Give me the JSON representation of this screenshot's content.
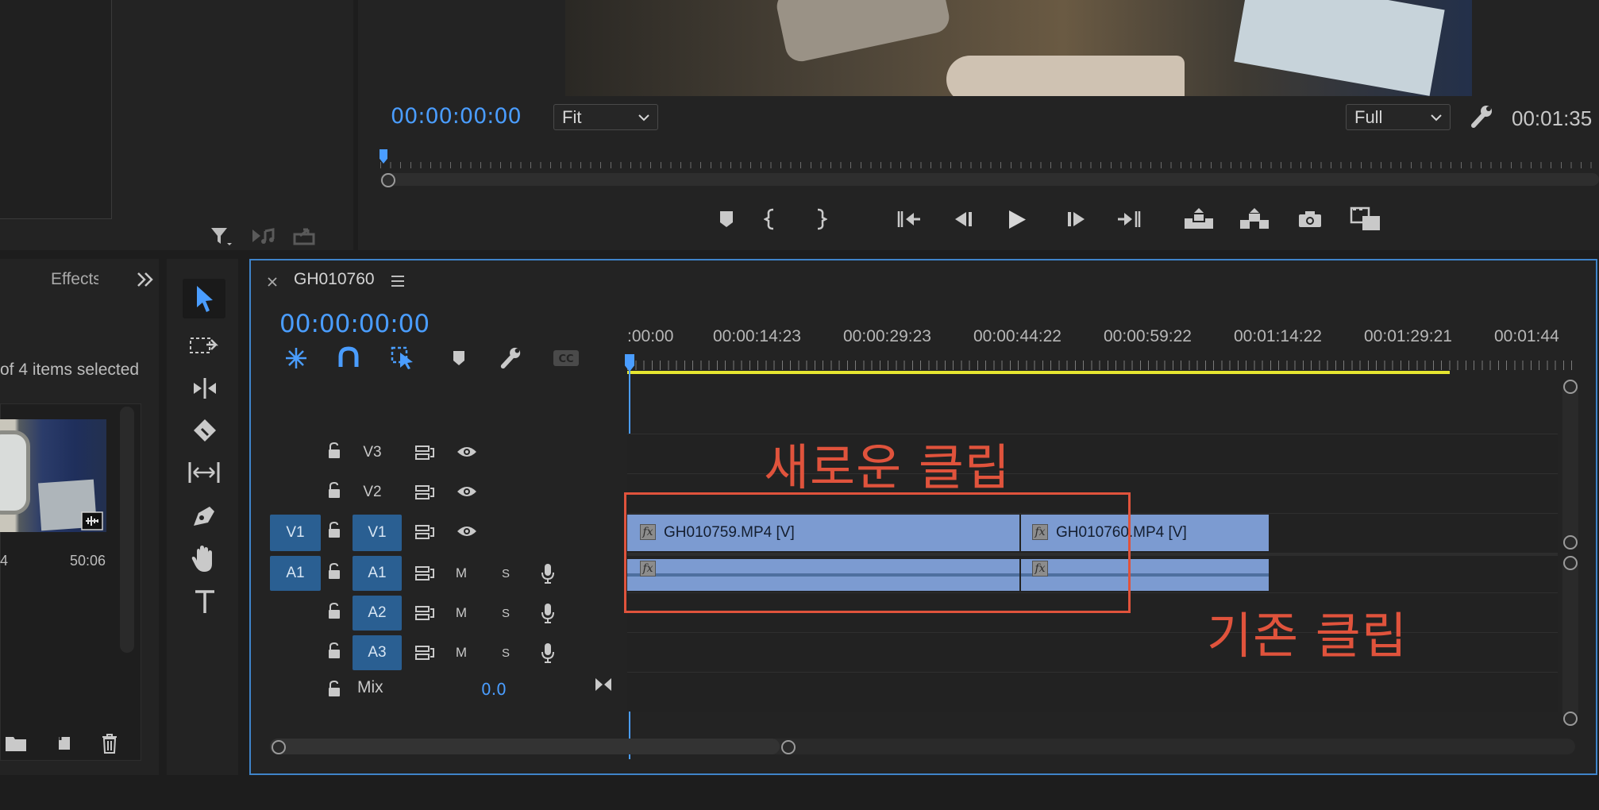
{
  "program_monitor": {
    "timecode": "00:00:00:00",
    "fit_select": "Fit",
    "quality_select": "Full",
    "duration": "00:01:35",
    "controls": [
      "add-marker-icon",
      "mark-in-icon",
      "mark-out-icon",
      "go-to-in-icon",
      "step-back-icon",
      "play-icon",
      "step-forward-icon",
      "go-to-out-icon",
      "lift-icon",
      "extract-icon",
      "export-frame-icon",
      "compare-view-icon"
    ]
  },
  "project_panel": {
    "tab_label": "Effects",
    "selection_text": "of 4 items selected",
    "thumb_left_label": "4",
    "thumb_duration": "50:06"
  },
  "timeline": {
    "sequence_name": "GH010760",
    "timecode": "00:00:00:00",
    "ruler_labels": [
      ":00:00",
      "00:00:14:23",
      "00:00:29:23",
      "00:00:44:22",
      "00:00:59:22",
      "00:01:14:22",
      "00:01:29:21",
      "00:01:44"
    ],
    "tracks": {
      "v3": "V3",
      "v2": "V2",
      "v1": "V1",
      "v1_source": "V1",
      "a1": "A1",
      "a1_source": "A1",
      "a2": "A2",
      "a3": "A3",
      "mute": "M",
      "solo": "S",
      "mix_label": "Mix",
      "mix_value": "0.0"
    },
    "clips": {
      "clip1_name": "GH010759.MP4 [V]",
      "clip2_name": "GH010760.MP4 [V]"
    }
  },
  "annotations": {
    "new_clip": "새로운 클립",
    "existing_clip": "기존 클립",
    "color": "#e0533c"
  },
  "colors": {
    "accent_blue": "#4a9dff",
    "clip_blue": "#7c9bd1",
    "work_area_yellow": "#e6e630",
    "track_active": "#2a5f92"
  }
}
